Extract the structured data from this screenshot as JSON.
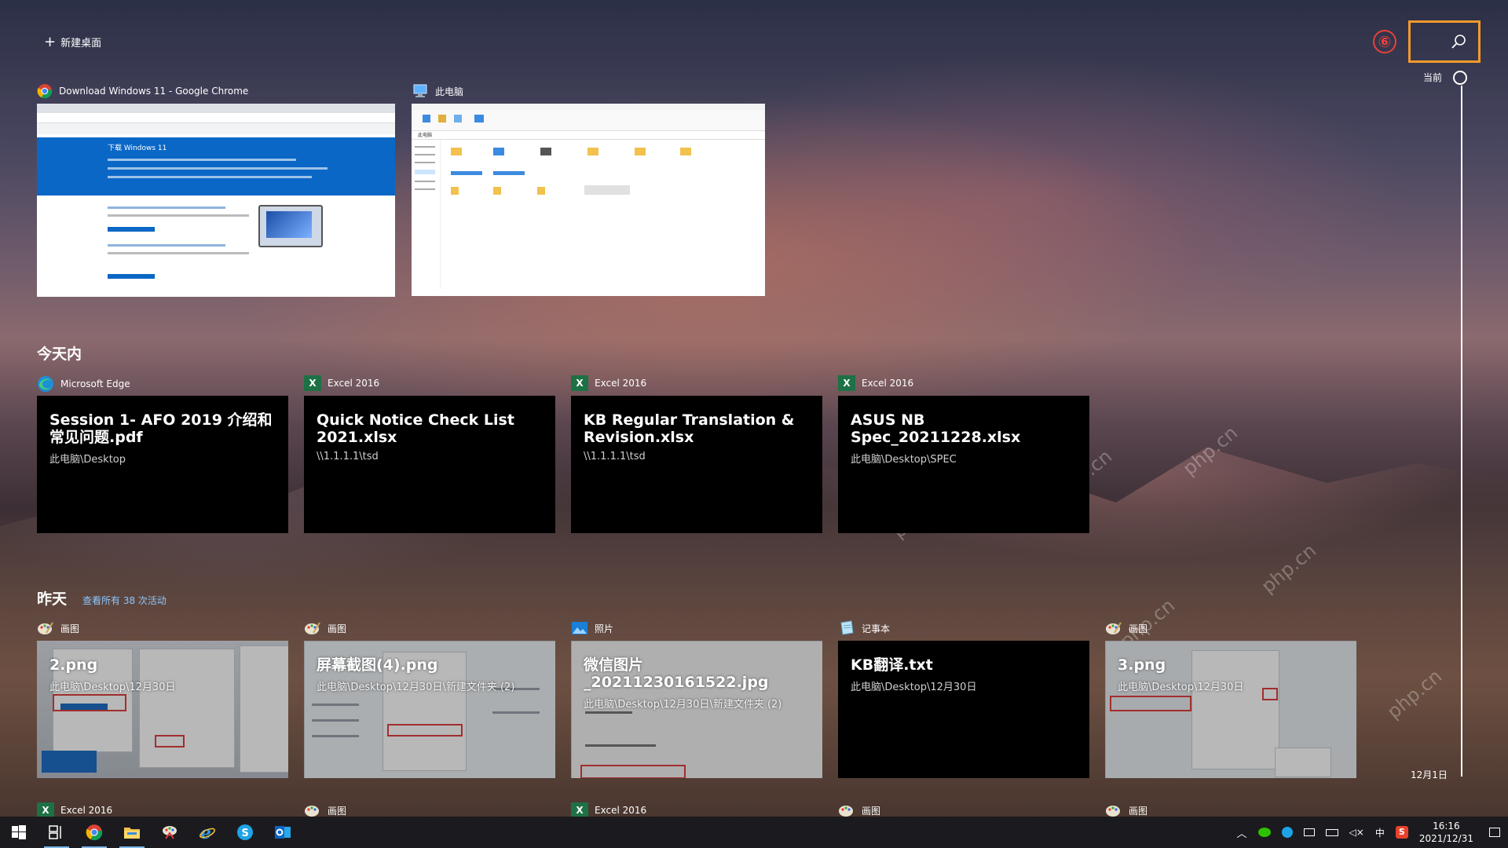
{
  "top": {
    "new_desktop": "新建桌面",
    "annotation_number": "⑥"
  },
  "timeline": {
    "now_label": "当前",
    "date_label": "12月1日"
  },
  "windows": [
    {
      "app_title": "Download Windows 11 - Google Chrome",
      "icon": "chrome-icon"
    },
    {
      "app_title": "此电脑",
      "icon": "this-pc-icon"
    }
  ],
  "today": {
    "heading": "今天内",
    "cards": [
      {
        "app": "Microsoft Edge",
        "title": "Session 1- AFO 2019 介绍和常见问题.pdf",
        "path": "此电脑\\Desktop"
      },
      {
        "app": "Excel 2016",
        "title": "Quick Notice Check List 2021.xlsx",
        "path": "\\\\1.1.1.1\\tsd"
      },
      {
        "app": "Excel 2016",
        "title": "KB Regular Translation & Revision.xlsx",
        "path": "\\\\1.1.1.1\\tsd"
      },
      {
        "app": "Excel 2016",
        "title": "ASUS NB Spec_20211228.xlsx",
        "path": "此电脑\\Desktop\\SPEC"
      }
    ]
  },
  "yesterday": {
    "heading": "昨天",
    "see_all": "查看所有 38 次活动",
    "cards": [
      {
        "app": "画图",
        "title": "2.png",
        "path": "此电脑\\Desktop\\12月30日"
      },
      {
        "app": "画图",
        "title": "屏幕截图(4).png",
        "path": "此电脑\\Desktop\\12月30日\\新建文件夹 (2)"
      },
      {
        "app": "照片",
        "title": "微信图片_20211230161522.jpg",
        "path": "此电脑\\Desktop\\12月30日\\新建文件夹 (2)"
      },
      {
        "app": "记事本",
        "title": "KB翻译.txt",
        "path": "此电脑\\Desktop\\12月30日"
      },
      {
        "app": "画图",
        "title": "3.png",
        "path": "此电脑\\Desktop\\12月30日"
      }
    ]
  },
  "next_row": [
    "Excel 2016",
    "画图",
    "Excel 2016",
    "画图",
    "画图"
  ],
  "thumbnail_text": {
    "chrome_heading": "下载 Windows 11",
    "explorer_path": "此电脑"
  },
  "tray": {
    "ime": "中",
    "time": "16:16",
    "date": "2021/12/31"
  },
  "colors": {
    "accent": "#f39a2b",
    "annotation": "#e8413a",
    "link": "#8cc7ff",
    "taskbar": "#1b1b1f"
  }
}
